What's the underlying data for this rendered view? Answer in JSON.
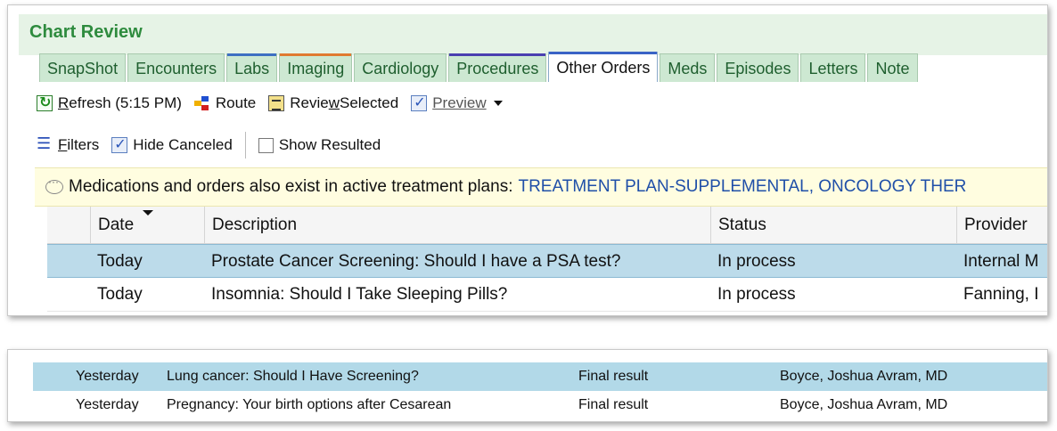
{
  "title": "Chart Review",
  "tabs": [
    {
      "label": "SnapShot",
      "strip": ""
    },
    {
      "label": "Encounters",
      "strip": ""
    },
    {
      "label": "Labs",
      "strip": "#3d6fc2"
    },
    {
      "label": "Imaging",
      "strip": "#e07a30"
    },
    {
      "label": "Cardiology",
      "strip": ""
    },
    {
      "label": "Procedures",
      "strip": "#4a3fb0"
    },
    {
      "label": "Other Orders",
      "strip": "#3a63c6",
      "active": true
    },
    {
      "label": "Meds",
      "strip": ""
    },
    {
      "label": "Episodes",
      "strip": ""
    },
    {
      "label": "Letters",
      "strip": ""
    },
    {
      "label": "Note",
      "strip": ""
    }
  ],
  "toolbar": {
    "refresh_u": "R",
    "refresh_rest": "efresh (5:15 PM)",
    "route": "Route",
    "review_a": "Revie",
    "review_u": "w",
    "review_b": " Selected",
    "preview": "Preview",
    "filters_u": "F",
    "filters_rest": "ilters",
    "hide_canceled": "Hide Canceled",
    "show_resulted": "Show Resulted"
  },
  "notice": {
    "text": "Medications and orders also exist in active treatment plans:",
    "link": "TREATMENT PLAN-SUPPLEMENTAL, ONCOLOGY THER"
  },
  "grid": {
    "headers": [
      "Date",
      "Description",
      "Status",
      "Provider"
    ],
    "rows": [
      {
        "date": "Today",
        "description": "Prostate Cancer Screening: Should I have a PSA test?",
        "status": "In process",
        "provider": "Internal M",
        "selected": true
      },
      {
        "date": "Today",
        "description": "Insomnia: Should I Take Sleeping Pills?",
        "status": "In process",
        "provider": "Fanning, I",
        "selected": false
      }
    ]
  },
  "grid2": {
    "rows": [
      {
        "date": "Yesterday",
        "description": "Lung cancer: Should I Have Screening?",
        "status": "Final result",
        "provider": "Boyce, Joshua Avram, MD",
        "selected": true
      },
      {
        "date": "Yesterday",
        "description": "Pregnancy: Your birth options after Cesarean",
        "status": "Final result",
        "provider": "Boyce, Joshua Avram, MD",
        "selected": false
      }
    ]
  },
  "colors": {
    "accent_green": "#2e8b3e",
    "selected_row": "#bcdbea",
    "link_blue": "#1f4fa8"
  }
}
